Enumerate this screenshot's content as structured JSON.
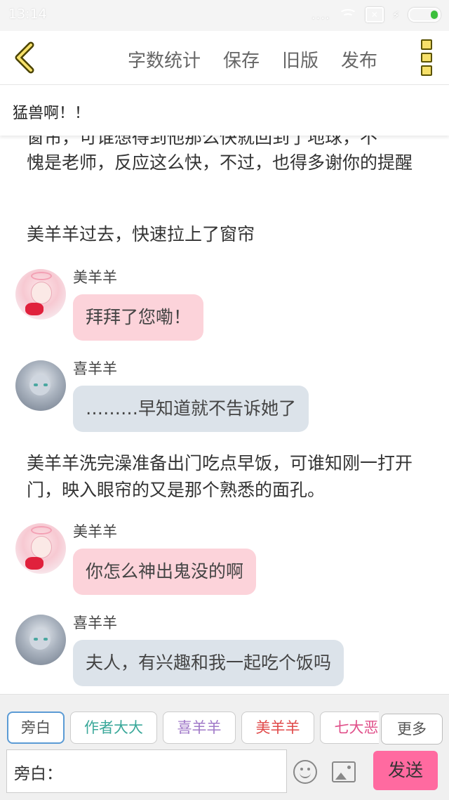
{
  "status_bar": {
    "time": "13:14",
    "signal_dots": "...."
  },
  "header": {
    "nav": [
      "字数统计",
      "保存",
      "旧版",
      "发布"
    ]
  },
  "story_title": "猛兽啊！！",
  "feed": {
    "narr_top_clipped": "窗帘，可谁想得到他那么快就回到了地球，不",
    "narr1": "愧是老师，反应这么快，不过，也得多谢你的提醒",
    "narr2": "美羊羊过去，快速拉上了窗帘",
    "msg1": {
      "name": "美羊羊",
      "text": "拜拜了您嘞！"
    },
    "msg2": {
      "name": "喜羊羊",
      "text": "………早知道就不告诉她了"
    },
    "narr3": "美羊羊洗完澡准备出门吃点早饭，可谁知刚一打开门，映入眼帘的又是那个熟悉的面孔。",
    "msg3": {
      "name": "美羊羊",
      "text": "你怎么神出鬼没的啊"
    },
    "msg4": {
      "name": "喜羊羊",
      "text": "夫人，有兴趣和我一起吃个饭吗"
    }
  },
  "composer": {
    "roles": [
      {
        "label": "旁白",
        "color": "#555555"
      },
      {
        "label": "作者大大",
        "color": "#3aa89a"
      },
      {
        "label": "喜羊羊",
        "color": "#a078c8"
      },
      {
        "label": "美羊羊",
        "color": "#e04848"
      },
      {
        "label": "七大恶",
        "color": "#e0508a"
      }
    ],
    "more_label": "更多",
    "input_label": "旁白：",
    "input_value": "",
    "send_label": "发送"
  },
  "colors": {
    "accent_pink": "#ff6aa0",
    "bubble_pink": "#fcd3da",
    "bubble_grey": "#dce3ea"
  }
}
